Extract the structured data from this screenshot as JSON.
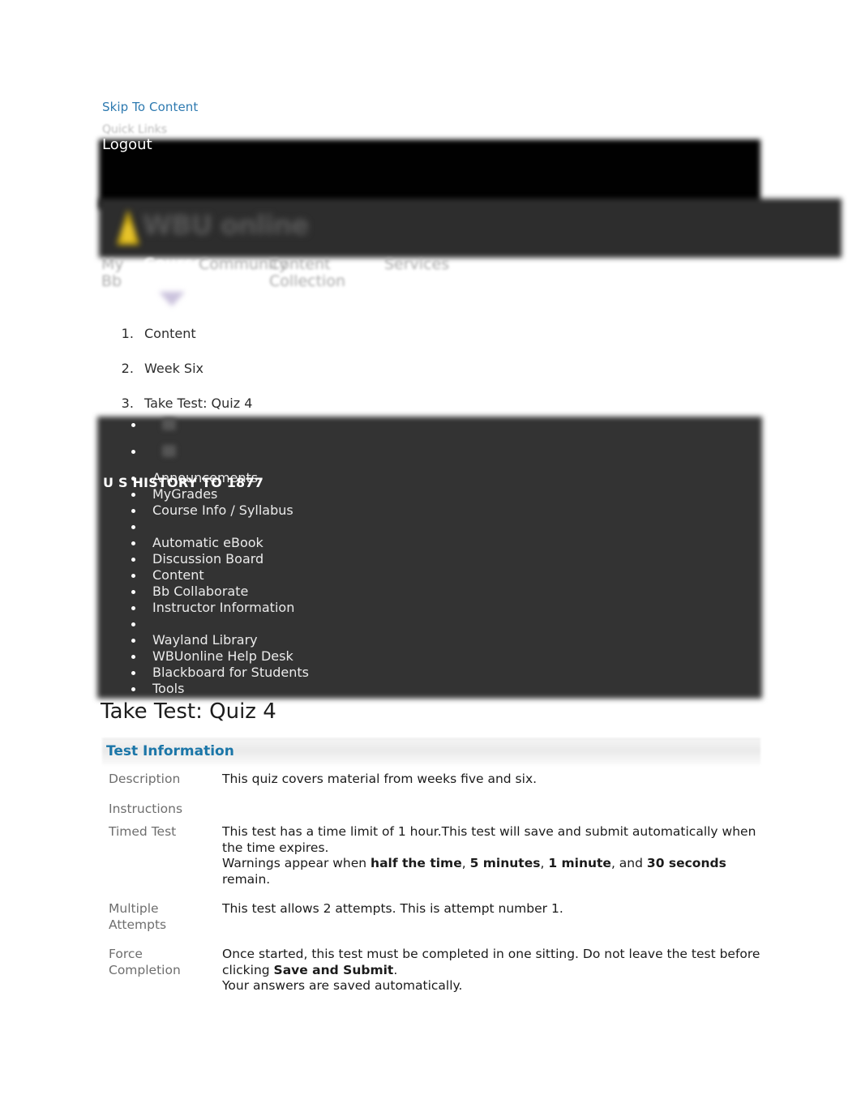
{
  "accessibility": {
    "skip_link": "Skip To Content"
  },
  "topbar": {
    "quick_links": "Quick Links",
    "logout": "Logout"
  },
  "banner": {
    "wordmark": "WBU online",
    "logo_icon": "flame-logo-icon"
  },
  "globalnav": {
    "tabs": [
      {
        "label": "My Bb",
        "active": false
      },
      {
        "label": "Courses",
        "active": true
      },
      {
        "label": "Community",
        "active": false
      },
      {
        "label": "Content Collection",
        "active": false
      },
      {
        "label": "Services",
        "active": false
      }
    ]
  },
  "breadcrumb": {
    "items": [
      "Content",
      "Week Six",
      "Take Test: Quiz 4"
    ]
  },
  "coursemenu": {
    "course_title": "U S HISTORY TO 1877",
    "items": [
      {
        "label": "",
        "type": "icon"
      },
      {
        "label": "",
        "type": "icon"
      },
      {
        "label": "Announcements",
        "type": "link"
      },
      {
        "label": "MyGrades",
        "type": "link"
      },
      {
        "label": "Course Info / Syllabus",
        "type": "link"
      },
      {
        "label": "",
        "type": "divider"
      },
      {
        "label": "Automatic eBook",
        "type": "link"
      },
      {
        "label": "Discussion Board",
        "type": "link"
      },
      {
        "label": "Content",
        "type": "link"
      },
      {
        "label": "Bb Collaborate",
        "type": "link"
      },
      {
        "label": "Instructor Information",
        "type": "link"
      },
      {
        "label": "",
        "type": "divider"
      },
      {
        "label": "Wayland Library",
        "type": "link"
      },
      {
        "label": "WBUonline Help Desk",
        "type": "link"
      },
      {
        "label": "Blackboard for Students",
        "type": "link"
      },
      {
        "label": "Tools",
        "type": "link"
      }
    ]
  },
  "page": {
    "title": "Take Test: Quiz 4"
  },
  "test_information": {
    "section_title": "Test Information",
    "rows": [
      {
        "label": "Description",
        "value_html": "This quiz covers material from weeks five and six."
      },
      {
        "label": "Instructions",
        "value_html": ""
      },
      {
        "label": "Timed Test",
        "value_html": "This test has a time limit of 1 hour.This test will save and submit automatically when the time expires.<br>Warnings appear when <b>half the time</b>, <b>5 minutes</b>, <b>1 minute</b>, and <b>30 seconds</b> remain."
      },
      {
        "label": "Multiple Attempts",
        "value_html": "This test allows 2 attempts. This is attempt number 1."
      },
      {
        "label": "Force Completion",
        "value_html": "Once started, this test must be completed in one sitting. Do not leave the test before clicking <b>Save and Submit</b>.<p>Your answers are saved automatically.</p>"
      }
    ]
  },
  "colors": {
    "link_blue": "#2e7ab0",
    "section_heading_blue": "#1b76a8",
    "dark_panel": "#333333",
    "logo_yellow": "#e8c42a"
  }
}
